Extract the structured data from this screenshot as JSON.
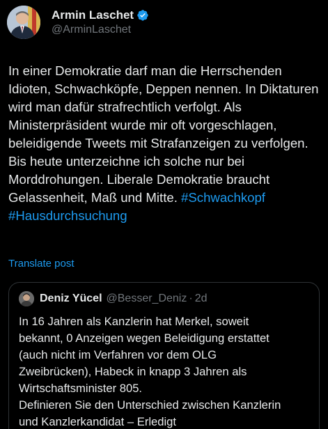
{
  "author": {
    "display_name": "Armin Laschet",
    "handle": "@ArminLaschet",
    "verified_icon": "verified-badge-icon"
  },
  "tweet": {
    "text_before": "In einer Demokratie darf man die Herrschenden Idioten, Schwachköpfe, Deppen nennen. In Diktaturen wird man dafür strafrechtlich verfolgt. Als Ministerpräsident wurde mir oft vorgeschlagen, beleidigende Tweets mit Strafanzeigen zu verfolgen. Bis heute unterzeichne ich solche nur bei Morddrohungen. Liberale Demokratie braucht Gelassenheit, Maß und Mitte. ",
    "hashtags": [
      "#Schwachkopf",
      "#Hausdurchsuchung"
    ]
  },
  "translate_label": "Translate post",
  "quote": {
    "display_name": "Deniz Yücel",
    "handle": "@Besser_Deniz",
    "separator": "·",
    "time": "2d",
    "lines": [
      "In 16 Jahren als Kanzlerin hat Merkel, soweit",
      "bekannt, 0 Anzeigen wegen Beleidigung erstattet",
      "(auch nicht im Verfahren vor dem OLG",
      "Zweibrücken), Habeck in knapp 3 Jahren als",
      "Wirtschaftsminister 805.",
      "Definieren Sie den Unterschied zwischen Kanzlerin",
      "und Kanzlerkandidat – Erledigt"
    ]
  },
  "colors": {
    "background": "#000000",
    "text": "#e7e9ea",
    "muted": "#71767b",
    "accent": "#1d9bf0",
    "border": "#2f3336"
  }
}
